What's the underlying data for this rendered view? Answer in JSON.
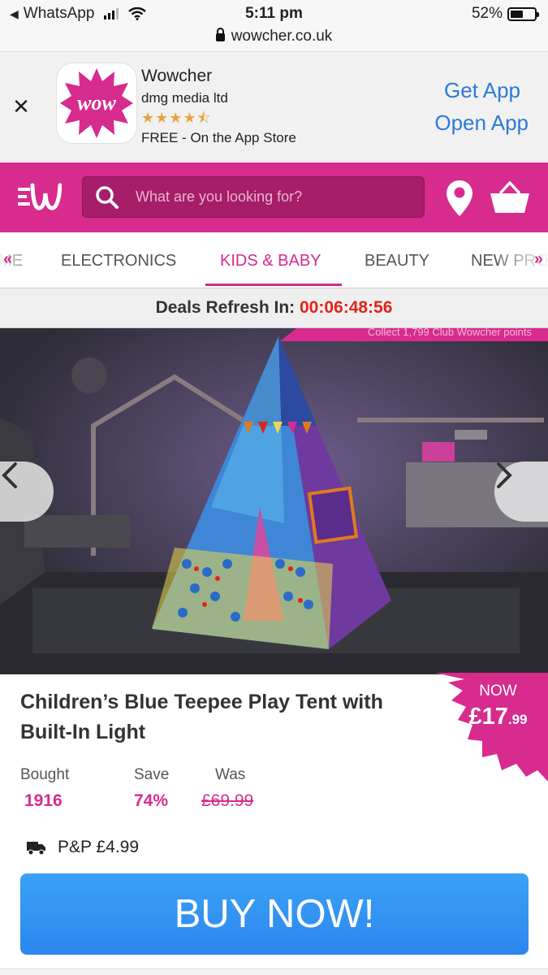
{
  "status_bar": {
    "back_app": "WhatsApp",
    "time": "5:11 pm",
    "battery_text": "52%",
    "battery_level": 0.52
  },
  "url_bar": {
    "domain": "wowcher.co.uk"
  },
  "app_banner": {
    "app_icon_text": "wow",
    "app_name": "Wowcher",
    "developer": "dmg media ltd",
    "rating": 4.5,
    "stars": "★★★★⯪",
    "store_text": "FREE - On the App Store",
    "get_app_label": "Get App",
    "open_app_label": "Open App",
    "close_icon": "✕"
  },
  "header": {
    "logo_icon": "wowcher-logo-icon",
    "search": {
      "placeholder": "What are you looking for?"
    },
    "location_icon": "map-pin-icon",
    "basket_icon": "basket-icon",
    "brand_color": "#d72b8e"
  },
  "nav": {
    "items": [
      {
        "label": "ME"
      },
      {
        "label": "ELECTRONICS"
      },
      {
        "label": "KIDS & BABY"
      },
      {
        "label": "BEAUTY"
      },
      {
        "label": "NEW PRO"
      }
    ],
    "active_index": 2,
    "scroll_left_icon": "chevron-left-icon",
    "scroll_right_icon": "chevron-right-icon"
  },
  "deals": {
    "label": "Deals Refresh In:",
    "timer": "00:06:48:56"
  },
  "hero": {
    "points_text": "Collect 1,799 Club Wowcher points",
    "prev_icon": "chevron-left-icon",
    "next_icon": "chevron-right-icon"
  },
  "product": {
    "title": "Children’s Blue Teepee Play Tent with Built-In Light",
    "now_label": "NOW",
    "price_main": "£17",
    "price_pence": ".99",
    "bought_label": "Bought",
    "bought_value": "1916",
    "save_label": "Save",
    "save_value": "74%",
    "was_label": "Was",
    "was_value": "£69.99",
    "pp_text": "P&P £4.99",
    "buy_label": "BUY NOW!"
  }
}
